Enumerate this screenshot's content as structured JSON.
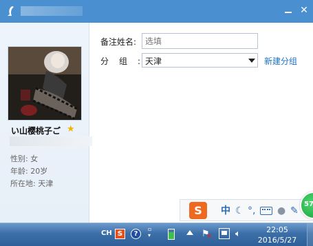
{
  "window": {
    "minimize_label": "—",
    "close_label": "✕"
  },
  "profile": {
    "nickname": "い山樱桃子ご",
    "gender": "性别: 女",
    "age": "年龄: 20岁",
    "location": "所在地:  天津"
  },
  "form": {
    "remark_label": "备注姓名:",
    "remark_placeholder": "选填",
    "group_label": "分组:",
    "group_value": "天津",
    "new_group_link": "新建分组"
  },
  "ime_toolbar": {
    "logo": "S",
    "lang": "中",
    "moon": "☾",
    "punct": "°,",
    "person": "●",
    "wrench": "✎"
  },
  "badge": {
    "value": "57"
  },
  "taskbar": {
    "lang_indicator": "CH",
    "sogou": "S",
    "help": "?",
    "time": "22:05",
    "date": "2016/5/27"
  },
  "colors": {
    "titlebar": "#4a90d0",
    "link": "#1e73c4",
    "sogou_orange": "#ef6a21",
    "taskbar": "#3c6fa8"
  }
}
